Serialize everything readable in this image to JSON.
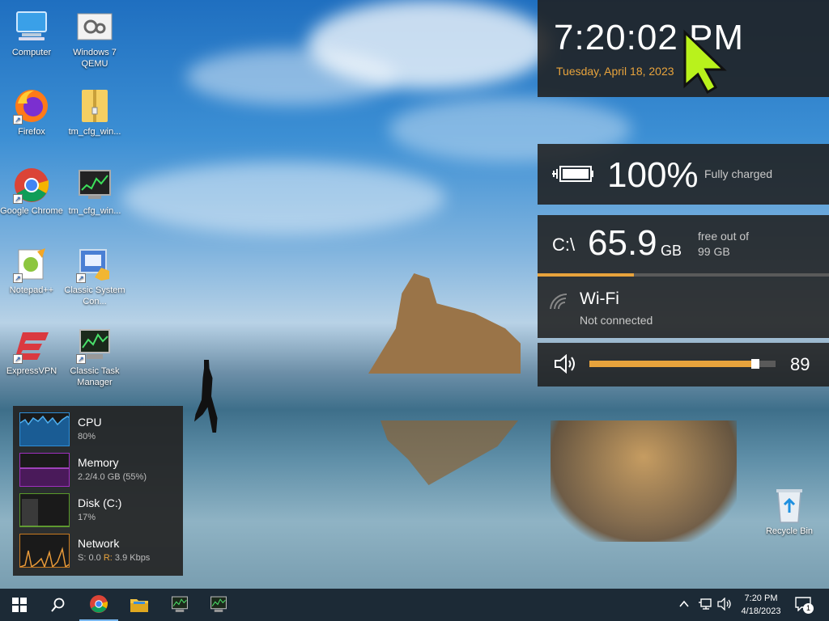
{
  "desktop_icons": [
    {
      "label": "Computer",
      "icon": "computer-icon"
    },
    {
      "label": "Windows 7 QEMU",
      "icon": "gear-icon"
    },
    {
      "label": "Firefox",
      "icon": "firefox-icon"
    },
    {
      "label": "tm_cfg_win...",
      "icon": "zip-folder-icon"
    },
    {
      "label": "Google Chrome",
      "icon": "chrome-icon"
    },
    {
      "label": "tm_cfg_win...",
      "icon": "monitor-graph-icon"
    },
    {
      "label": "Notepad++",
      "icon": "notepad-plus-plus-icon"
    },
    {
      "label": "Classic System Con...",
      "icon": "control-panel-icon"
    },
    {
      "label": "ExpressVPN",
      "icon": "expressvpn-icon"
    },
    {
      "label": "Classic Task Manager",
      "icon": "task-manager-icon"
    },
    {
      "label": "Recycle Bin",
      "icon": "recycle-bin-icon"
    }
  ],
  "clock_widget": {
    "time": "7:20:02 PM",
    "date": "Tuesday, April 18, 2023"
  },
  "battery_widget": {
    "percent": "100%",
    "status": "Fully charged"
  },
  "disk_widget": {
    "drive": "C:\\",
    "free_value": "65.9",
    "free_unit": "GB",
    "detail_line1": "free out of",
    "detail_line2": "99 GB",
    "used_fraction": 0.33
  },
  "wifi_widget": {
    "name": "Wi-Fi",
    "status": "Not connected"
  },
  "volume_widget": {
    "level": 89,
    "level_label": "89"
  },
  "perf_monitor": {
    "items": [
      {
        "title": "CPU",
        "value": "80%",
        "color": "#2f8fd8"
      },
      {
        "title": "Memory",
        "value": "2.2/4.0 GB (55%)",
        "color": "#a030c0"
      },
      {
        "title": "Disk (C:)",
        "value": "17%",
        "color": "#5a9a2a"
      },
      {
        "title": "Network",
        "value_s_label": "S:",
        "value_s": "0.0",
        "value_r_label": "R:",
        "value_r": "3.9 Kbps",
        "color": "#c87a20"
      }
    ]
  },
  "taskbar": {
    "time": "7:20 PM",
    "date": "4/18/2023",
    "notification_count": "1",
    "buttons": [
      "start-icon",
      "search-icon",
      "chrome-icon",
      "file-explorer-icon",
      "task-manager-icon",
      "task-manager-icon"
    ]
  },
  "colors": {
    "accent_orange": "#e8a33c",
    "panel_bg": "#202020"
  }
}
